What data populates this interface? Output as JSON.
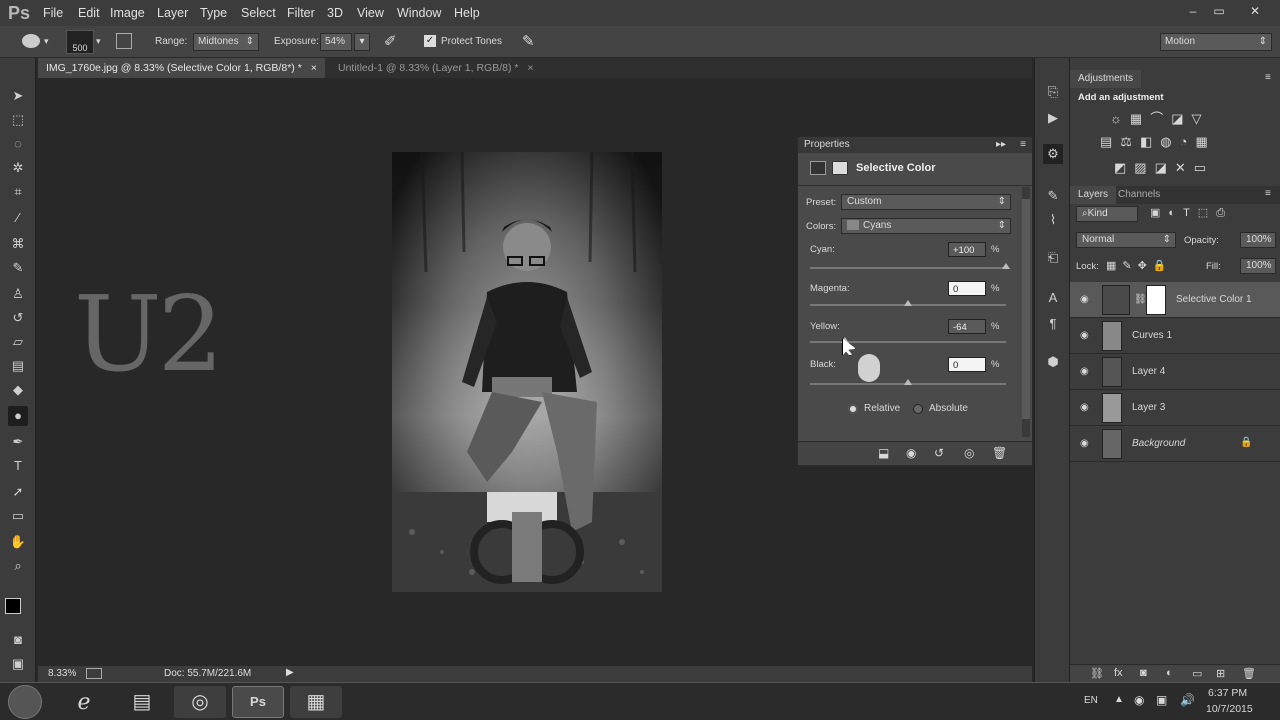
{
  "app": {
    "logo": "Ps"
  },
  "menu": {
    "items": [
      "File",
      "Edit",
      "Image",
      "Layer",
      "Type",
      "Select",
      "Filter",
      "3D",
      "View",
      "Window",
      "Help"
    ]
  },
  "window_controls": {
    "minimize": "–",
    "maximize": "▭",
    "close": "✕"
  },
  "options": {
    "brush_size": "500",
    "range_label": "Range:",
    "range_value": "Midtones",
    "exposure_label": "Exposure:",
    "exposure_value": "54%",
    "protect_tones_label": "Protect Tones",
    "workspace": "Motion"
  },
  "doc_tabs": [
    {
      "label": "IMG_1760e.jpg @ 8.33% (Selective Color 1, RGB/8*) *",
      "close": "×"
    },
    {
      "label": "Untitled-1 @ 8.33% (Layer 1, RGB/8) *",
      "close": "×"
    }
  ],
  "watermark": {
    "logo": "U2"
  },
  "status": {
    "zoom": "8.33%",
    "doc": "Doc: 55.7M/221.6M"
  },
  "properties": {
    "title": "Properties",
    "panel_name": "Selective Color",
    "preset_label": "Preset:",
    "preset_value": "Custom",
    "colors_label": "Colors:",
    "colors_value": "Cyans",
    "cyan_label": "Cyan:",
    "cyan_value": "+100",
    "cyan_level": 1.0,
    "magenta_label": "Magenta:",
    "magenta_value": "0",
    "magenta_level": 0.5,
    "yellow_label": "Yellow:",
    "yellow_value": "-64",
    "yellow_level": 0.18,
    "black_label": "Black:",
    "black_value": "0",
    "black_level": 0.5,
    "unit": "%",
    "relative_label": "Relative",
    "absolute_label": "Absolute"
  },
  "adjustments": {
    "title": "Adjustments",
    "subtitle": "Add an adjustment"
  },
  "layers_panel": {
    "tabs": [
      "Layers",
      "Channels"
    ],
    "kind": "Kind",
    "blend_mode": "Normal",
    "opacity_label": "Opacity:",
    "opacity_value": "100%",
    "lock_label": "Lock:",
    "fill_label": "Fill:",
    "fill_value": "100%",
    "layers": [
      {
        "name": "Selective Color 1"
      },
      {
        "name": "Curves 1"
      },
      {
        "name": "Layer 4"
      },
      {
        "name": "Layer 3"
      },
      {
        "name": "Background"
      }
    ]
  },
  "taskbar": {
    "lang": "EN",
    "time": "6:37 PM",
    "date": "10/7/2015"
  }
}
